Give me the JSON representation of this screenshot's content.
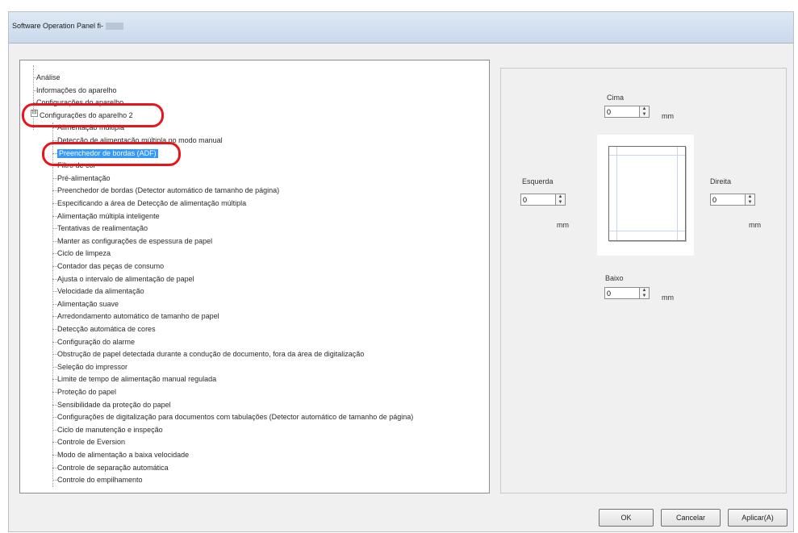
{
  "window": {
    "title": "Software Operation Panel fi-"
  },
  "tree": {
    "items": [
      {
        "label": "Análise"
      },
      {
        "label": "Informações do aparelho"
      },
      {
        "label": "Configurações do aparelho"
      },
      {
        "label": "Configurações do aparelho 2"
      },
      {
        "label": "Alimentação múltipla"
      },
      {
        "label": "Detecção de alimentação múltipla no modo manual"
      },
      {
        "label": "Preenchedor de bordas (ADF)"
      },
      {
        "label": "Filtro de cor"
      },
      {
        "label": "Pré-alimentação"
      },
      {
        "label": "Preenchedor de bordas (Detector automático de tamanho de página)"
      },
      {
        "label": "Especificando a área de Detecção de alimentação múltipla"
      },
      {
        "label": "Alimentação múltipla inteligente"
      },
      {
        "label": "Tentativas de realimentação"
      },
      {
        "label": "Manter as configurações de espessura de papel"
      },
      {
        "label": "Ciclo de limpeza"
      },
      {
        "label": "Contador das peças de consumo"
      },
      {
        "label": "Ajusta o intervalo de alimentação de papel"
      },
      {
        "label": "Velocidade da alimentação"
      },
      {
        "label": "Alimentação suave"
      },
      {
        "label": "Arredondamento automático de tamanho de papel"
      },
      {
        "label": "Detecção automática de cores"
      },
      {
        "label": "Configuração do alarme"
      },
      {
        "label": "Obstrução de papel detectada durante a condução de documento, fora da área de digitalização"
      },
      {
        "label": "Seleção do impressor"
      },
      {
        "label": "Limite de tempo de alimentação manual regulada"
      },
      {
        "label": "Proteção do papel"
      },
      {
        "label": "Sensibilidade da proteção do papel"
      },
      {
        "label": "Configurações de digitalização para documentos com tabulações (Detector automático de tamanho de página)"
      },
      {
        "label": "Ciclo de manutenção e inspeção"
      },
      {
        "label": "Controle de Eversion"
      },
      {
        "label": "Modo de alimentação a baixa velocidade"
      },
      {
        "label": "Controle de separação automática"
      },
      {
        "label": "Controle do empilhamento"
      }
    ],
    "selected_index": 6,
    "expander_symbol": "⊟"
  },
  "edge_panel": {
    "top": {
      "label": "Cima",
      "value": "0",
      "unit": "mm"
    },
    "left": {
      "label": "Esquerda",
      "value": "0",
      "unit": "mm"
    },
    "right": {
      "label": "Direita",
      "value": "0",
      "unit": "mm"
    },
    "bottom": {
      "label": "Baixo",
      "value": "0",
      "unit": "mm"
    },
    "spin_up": "▲",
    "spin_down": "▼"
  },
  "buttons": {
    "ok": "OK",
    "cancel": "Cancelar",
    "apply": "Aplicar(A)"
  },
  "colors": {
    "selection": "#3399ff",
    "highlight_circle": "#e8161c"
  }
}
